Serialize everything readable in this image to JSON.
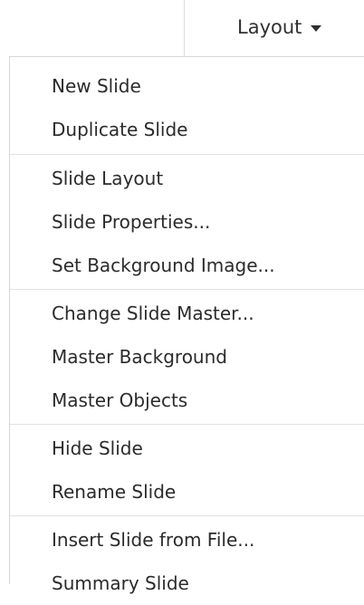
{
  "toolbar": {
    "layout_label": "Layout",
    "dropdown_icon": "triangle-down-icon"
  },
  "menu": {
    "groups": [
      {
        "items": [
          "New Slide",
          "Duplicate Slide"
        ]
      },
      {
        "items": [
          "Slide Layout",
          "Slide Properties...",
          "Set Background Image..."
        ]
      },
      {
        "items": [
          "Change Slide Master...",
          "Master Background",
          "Master Objects"
        ]
      },
      {
        "items": [
          "Hide Slide",
          "Rename Slide"
        ]
      },
      {
        "items": [
          "Insert Slide from File...",
          "Summary Slide"
        ]
      }
    ]
  }
}
